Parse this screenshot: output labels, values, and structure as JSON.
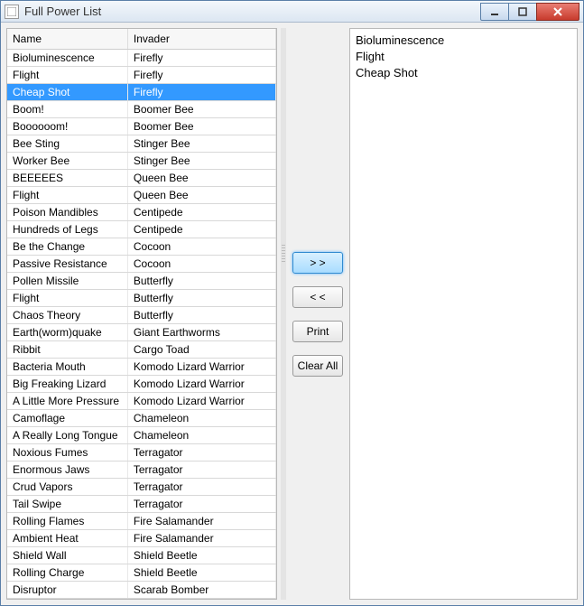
{
  "window": {
    "title": "Full Power List"
  },
  "table": {
    "headers": {
      "name": "Name",
      "invader": "Invader"
    },
    "rows": [
      {
        "name": "Bioluminescence",
        "invader": "Firefly",
        "selected": false
      },
      {
        "name": "Flight",
        "invader": "Firefly",
        "selected": false
      },
      {
        "name": "Cheap Shot",
        "invader": "Firefly",
        "selected": true
      },
      {
        "name": "Boom!",
        "invader": "Boomer Bee",
        "selected": false
      },
      {
        "name": "Boooooom!",
        "invader": "Boomer Bee",
        "selected": false
      },
      {
        "name": "Bee Sting",
        "invader": "Stinger Bee",
        "selected": false
      },
      {
        "name": "Worker Bee",
        "invader": "Stinger Bee",
        "selected": false
      },
      {
        "name": "BEEEEES",
        "invader": "Queen Bee",
        "selected": false
      },
      {
        "name": "Flight",
        "invader": "Queen Bee",
        "selected": false
      },
      {
        "name": "Poison Mandibles",
        "invader": "Centipede",
        "selected": false
      },
      {
        "name": "Hundreds of Legs",
        "invader": "Centipede",
        "selected": false
      },
      {
        "name": "Be the Change",
        "invader": "Cocoon",
        "selected": false
      },
      {
        "name": "Passive Resistance",
        "invader": "Cocoon",
        "selected": false
      },
      {
        "name": "Pollen Missile",
        "invader": "Butterfly",
        "selected": false
      },
      {
        "name": "Flight",
        "invader": "Butterfly",
        "selected": false
      },
      {
        "name": "Chaos Theory",
        "invader": "Butterfly",
        "selected": false
      },
      {
        "name": "Earth(worm)quake",
        "invader": "Giant Earthworms",
        "selected": false
      },
      {
        "name": "Ribbit",
        "invader": "Cargo Toad",
        "selected": false
      },
      {
        "name": "Bacteria Mouth",
        "invader": "Komodo Lizard Warrior",
        "selected": false
      },
      {
        "name": "Big Freaking Lizard",
        "invader": "Komodo Lizard Warrior",
        "selected": false
      },
      {
        "name": "A Little More Pressure",
        "invader": "Komodo Lizard Warrior",
        "selected": false
      },
      {
        "name": "Camoflage",
        "invader": "Chameleon",
        "selected": false
      },
      {
        "name": "A Really Long Tongue",
        "invader": "Chameleon",
        "selected": false
      },
      {
        "name": "Noxious Fumes",
        "invader": "Terragator",
        "selected": false
      },
      {
        "name": "Enormous Jaws",
        "invader": "Terragator",
        "selected": false
      },
      {
        "name": "Crud Vapors",
        "invader": "Terragator",
        "selected": false
      },
      {
        "name": "Tail Swipe",
        "invader": "Terragator",
        "selected": false
      },
      {
        "name": "Rolling Flames",
        "invader": "Fire Salamander",
        "selected": false
      },
      {
        "name": "Ambient Heat",
        "invader": "Fire Salamander",
        "selected": false
      },
      {
        "name": "Shield Wall",
        "invader": "Shield Beetle",
        "selected": false
      },
      {
        "name": "Rolling Charge",
        "invader": "Shield Beetle",
        "selected": false
      },
      {
        "name": "Disruptor",
        "invader": "Scarab Bomber",
        "selected": false
      }
    ]
  },
  "buttons": {
    "add": "> >",
    "remove": "< <",
    "print": "Print",
    "clear_all": "Clear All"
  },
  "right_list": [
    "Bioluminescence",
    "Flight",
    "Cheap Shot"
  ]
}
